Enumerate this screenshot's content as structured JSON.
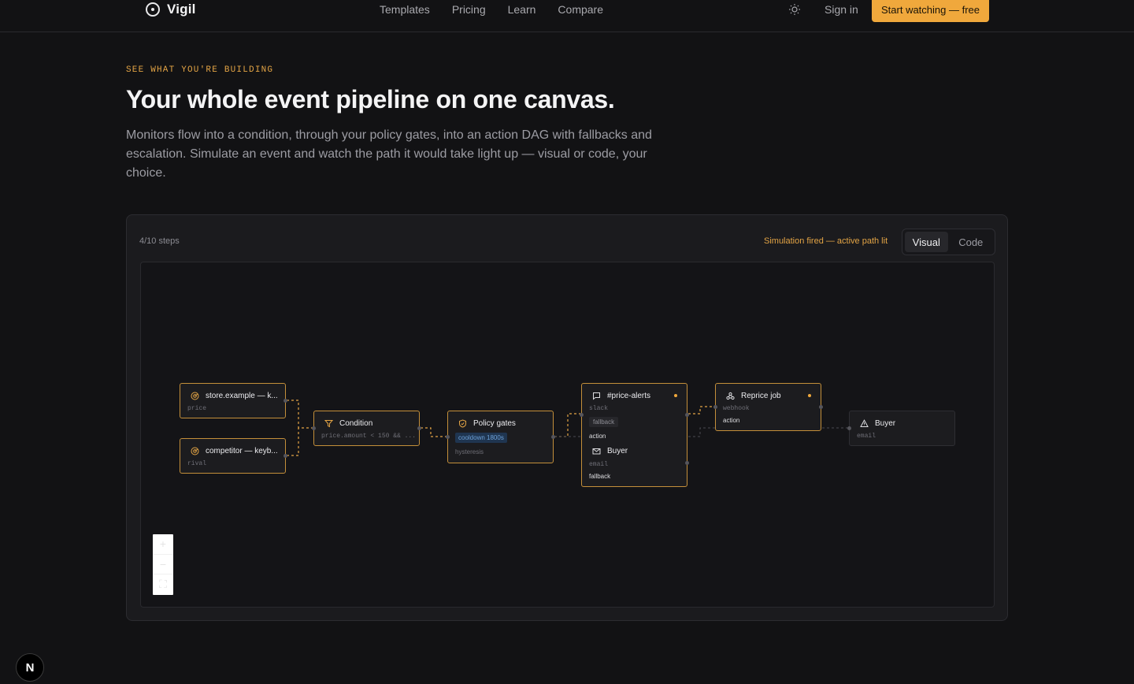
{
  "brand": {
    "name": "Vigil"
  },
  "nav": {
    "links": [
      "Templates",
      "Pricing",
      "Learn",
      "Compare"
    ],
    "sign_in": "Sign in",
    "cta": "Start watching — free"
  },
  "hero": {
    "eyebrow": "SEE WHAT YOU'RE BUILDING",
    "title": "Your whole event pipeline on one canvas.",
    "lead": "Monitors flow into a condition, through your policy gates, into an action DAG with fallbacks and escalation. Simulate an event and watch the path it would take light up — visual or code, your choice."
  },
  "panel": {
    "steps": "4/10 steps",
    "status": "Simulation fired — active path lit",
    "tabs": {
      "visual": "Visual",
      "code": "Code"
    }
  },
  "nodes": {
    "monitor1": {
      "title": "store.example — k...",
      "sub": "price"
    },
    "monitor2": {
      "title": "competitor — keyb...",
      "sub": "rival"
    },
    "condition": {
      "title": "Condition",
      "sub": "price.amount < 150 && ..."
    },
    "policy": {
      "title": "Policy gates",
      "chip": "cooldown 1800s",
      "sub": "hysteresis"
    },
    "alerts": {
      "title": "#price-alerts",
      "sub": "slack",
      "tag1": "fallback",
      "tag2": "action",
      "title2": "Buyer",
      "sub2": "email",
      "tag3": "fallback"
    },
    "reprice": {
      "title": "Reprice job",
      "sub": "webhook",
      "tag": "action"
    },
    "buyer": {
      "title": "Buyer",
      "sub": "email"
    }
  },
  "zoom": {
    "in": "+",
    "out": "−",
    "fit": "⛶"
  },
  "badge": {
    "label": "N"
  },
  "colors": {
    "accent": "#f0a83c",
    "background": "#121214",
    "panel": "#1b1b1e"
  }
}
